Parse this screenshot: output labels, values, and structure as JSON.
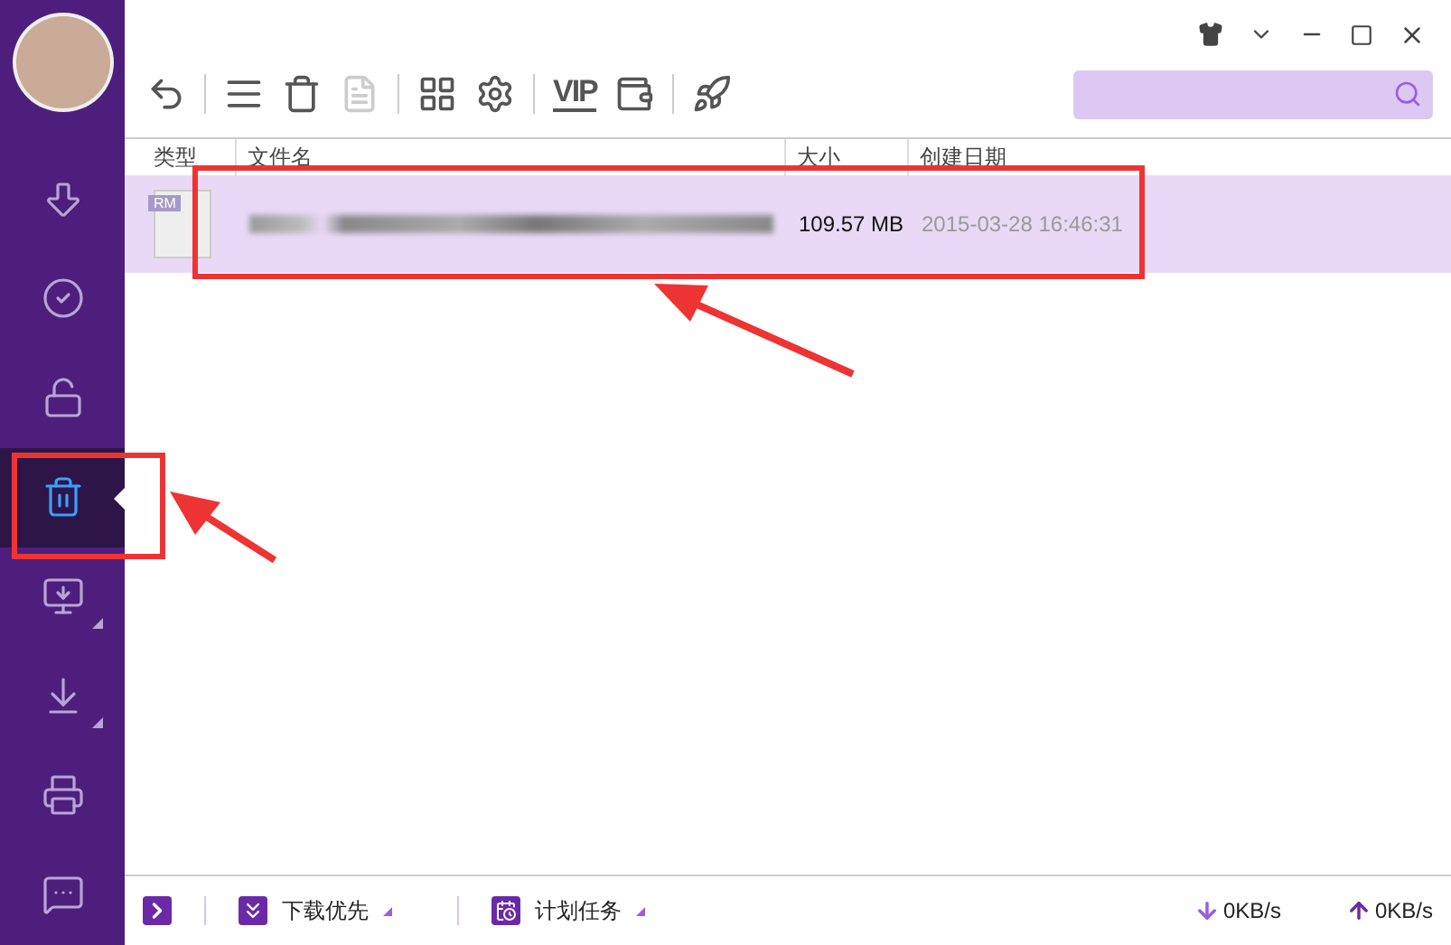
{
  "sidebar": {
    "items": [
      {
        "kind": "download",
        "selected": false,
        "has_menu": false
      },
      {
        "kind": "completed",
        "selected": false,
        "has_menu": false
      },
      {
        "kind": "private",
        "selected": false,
        "has_menu": false
      },
      {
        "kind": "trash",
        "selected": true,
        "has_menu": false
      },
      {
        "kind": "remote",
        "selected": false,
        "has_menu": true
      },
      {
        "kind": "local",
        "selected": false,
        "has_menu": true
      },
      {
        "kind": "store",
        "selected": false,
        "has_menu": false
      },
      {
        "kind": "chat",
        "selected": false,
        "has_menu": false
      }
    ]
  },
  "toolbar": {
    "vip_label": "VIP"
  },
  "table": {
    "columns": [
      "类型",
      "文件名",
      "大小",
      "创建日期"
    ],
    "rows": [
      {
        "type_badge": "RM",
        "size": "109.57 MB",
        "created": "2015-03-28 16:46:31",
        "selected": true
      }
    ]
  },
  "status_bar": {
    "priority_label": "下载优先",
    "schedule_label": "计划任务",
    "download_speed": "0KB/s",
    "upload_speed": "0KB/s"
  }
}
